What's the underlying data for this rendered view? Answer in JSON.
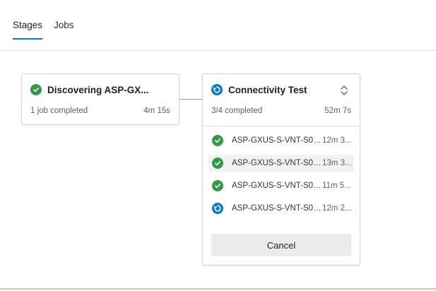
{
  "tabs": [
    {
      "label": "Stages",
      "active": true
    },
    {
      "label": "Jobs",
      "active": false
    }
  ],
  "stages": [
    {
      "title": "Discovering ASP-GX...",
      "status_icon": "success-check-icon",
      "summary": "1 job completed",
      "duration": "4m 15s"
    },
    {
      "title": "Connectivity Test",
      "status_icon": "running-icon",
      "summary": "3/4 completed",
      "duration": "52m 7s",
      "jobs": [
        {
          "name": "ASP-GXUS-S-VNT-S00...",
          "time": "12m 3...",
          "status": "success"
        },
        {
          "name": "ASP-GXUS-S-VNT-S00...",
          "time": "13m 3...",
          "status": "success"
        },
        {
          "name": "ASP-GXUS-S-VNT-S00...",
          "time": "11m 5...",
          "status": "success"
        },
        {
          "name": "ASP-GXUS-S-VNT-S00...",
          "time": "12m 2...",
          "status": "running"
        }
      ],
      "cancel_label": "Cancel"
    }
  ],
  "colors": {
    "accent": "#0078d4",
    "success": "#339947",
    "running": "#0078d4"
  }
}
